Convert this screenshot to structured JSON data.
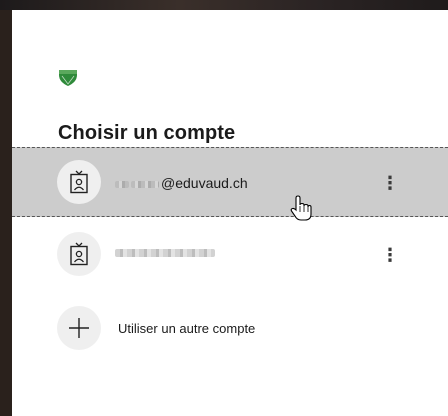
{
  "title": "Choisir un compte",
  "accounts": [
    {
      "email_suffix": "@eduvaud.ch",
      "avatar_icon": "badge-icon",
      "menu_label": "⋮",
      "selected": true
    },
    {
      "email_suffix": "",
      "avatar_icon": "badge-icon",
      "menu_label": "⋮",
      "selected": false
    }
  ],
  "add_account": {
    "label": "Utiliser un autre compte",
    "icon": "plus-icon"
  },
  "colors": {
    "selected_bg": "#cccccc",
    "logo": "#2f8a3a"
  }
}
